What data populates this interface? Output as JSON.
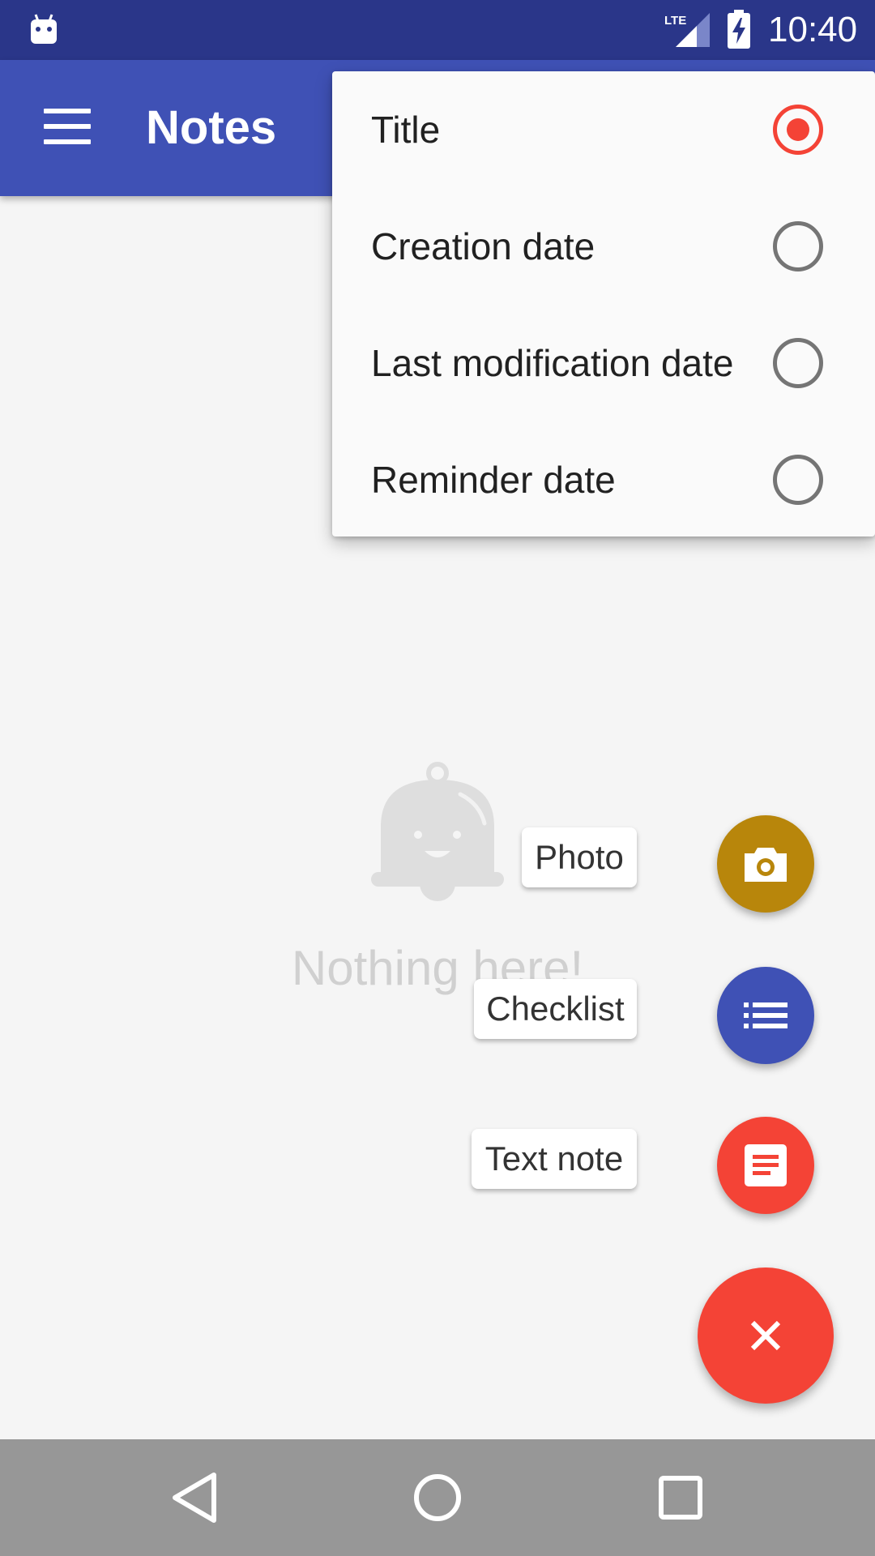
{
  "status_bar": {
    "time": "10:40",
    "network": "LTE",
    "icons": [
      "android-notification-icon",
      "lte-signal-icon",
      "battery-charging-icon"
    ]
  },
  "app_bar": {
    "title": "Notes",
    "menu_icon": "hamburger-menu-icon"
  },
  "empty_state": {
    "icon": "bell-smiley-icon",
    "message": "Nothing here!"
  },
  "sort_menu": {
    "selected_index": 0,
    "options": [
      {
        "label": "Title",
        "checked": true
      },
      {
        "label": "Creation date",
        "checked": false
      },
      {
        "label": "Last modification date",
        "checked": false
      },
      {
        "label": "Reminder date",
        "checked": false
      }
    ]
  },
  "fab_menu": {
    "items": [
      {
        "label": "Photo",
        "icon": "camera-icon",
        "color": "#b8860b"
      },
      {
        "label": "Checklist",
        "icon": "checklist-icon",
        "color": "#3f51b5"
      },
      {
        "label": "Text note",
        "icon": "text-note-icon",
        "color": "#f44336"
      }
    ],
    "main_fab": {
      "icon": "close-icon",
      "color": "#f44336"
    }
  },
  "nav_bar": {
    "buttons": [
      "back-icon",
      "home-icon",
      "recents-icon"
    ]
  },
  "colors": {
    "status_bar": "#2a3689",
    "app_bar": "#3f51b5",
    "accent": "#f44336",
    "background": "#f5f5f5",
    "nav_bar": "#979797"
  }
}
